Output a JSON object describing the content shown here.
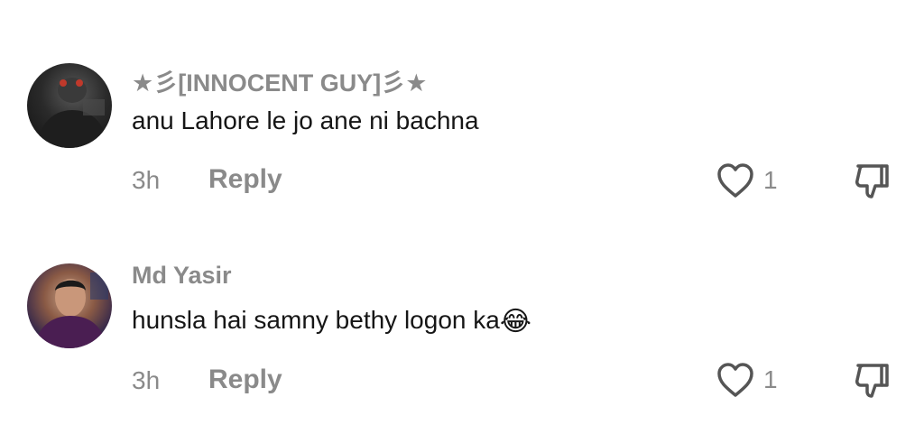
{
  "comments": [
    {
      "username": "★彡[INNOCENT GUY]彡★",
      "text": "anu Lahore le jo ane ni bachna",
      "emoji": "",
      "time": "3h",
      "reply_label": "Reply",
      "like_count": "1"
    },
    {
      "username": "Md Yasir",
      "text": "hunsla hai samny bethy logon ka",
      "emoji": "😂",
      "time": "3h",
      "reply_label": "Reply",
      "like_count": "1"
    }
  ],
  "icons": {
    "like": "heart-outline-icon",
    "dislike": "thumbs-down-outline-icon"
  },
  "colors": {
    "secondary_text": "#8a8a8a",
    "primary_text": "#161616",
    "background": "#ffffff"
  }
}
